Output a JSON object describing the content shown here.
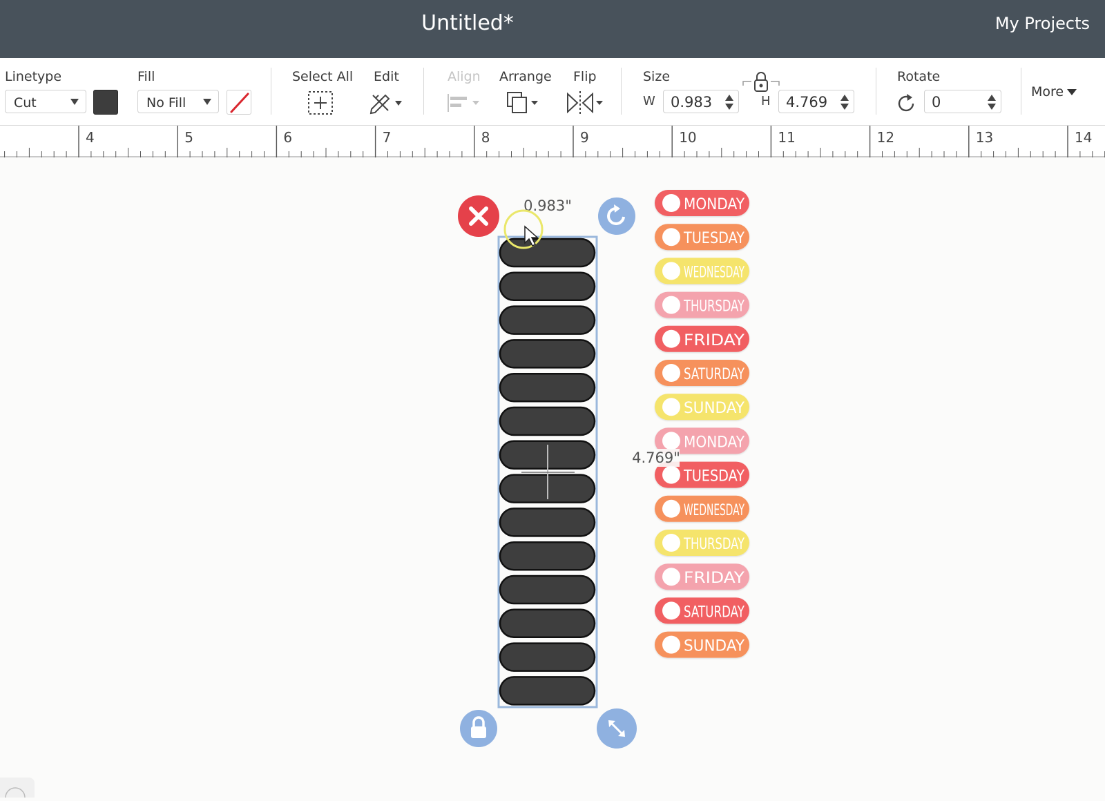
{
  "window": {
    "title": "Untitled*",
    "my_projects": "My Projects"
  },
  "toolbar": {
    "linetype": {
      "label": "Linetype",
      "value": "Cut",
      "color": "#3d3d3d"
    },
    "fill": {
      "label": "Fill",
      "value": "No Fill"
    },
    "select_all": {
      "label": "Select All"
    },
    "edit": {
      "label": "Edit"
    },
    "align": {
      "label": "Align"
    },
    "arrange": {
      "label": "Arrange"
    },
    "flip": {
      "label": "Flip"
    },
    "size": {
      "label": "Size",
      "w_label": "W",
      "w_value": "0.983",
      "h_label": "H",
      "h_value": "4.769"
    },
    "rotate": {
      "label": "Rotate",
      "value": "0"
    },
    "more": {
      "label": "More"
    }
  },
  "ruler": {
    "marks": [
      "4",
      "5",
      "6",
      "7",
      "8",
      "9",
      "10",
      "11",
      "12",
      "13",
      "14"
    ]
  },
  "canvas": {
    "width_readout": "0.983\"",
    "height_readout": "4.769\"",
    "dark_tabs_count": 14,
    "day_labels": [
      {
        "text": "MONDAY",
        "color": "#f15f62"
      },
      {
        "text": "TUESDAY",
        "color": "#f6915c"
      },
      {
        "text": "WEDNESDAY",
        "color": "#f5e46c"
      },
      {
        "text": "THURSDAY",
        "color": "#f4a3ad"
      },
      {
        "text": "FRIDAY",
        "color": "#f15f62"
      },
      {
        "text": "SATURDAY",
        "color": "#f6915c"
      },
      {
        "text": "SUNDAY",
        "color": "#f5e46c"
      },
      {
        "text": "MONDAY",
        "color": "#f4a3ad"
      },
      {
        "text": "TUESDAY",
        "color": "#f15f62"
      },
      {
        "text": "WEDNESDAY",
        "color": "#f6915c"
      },
      {
        "text": "THURSDAY",
        "color": "#f5e46c"
      },
      {
        "text": "FRIDAY",
        "color": "#f4a3ad"
      },
      {
        "text": "SATURDAY",
        "color": "#f15f62"
      },
      {
        "text": "SUNDAY",
        "color": "#f6915c"
      }
    ],
    "colors": {
      "delete": "#e5414a",
      "handle": "#8fb1e0",
      "selection": "#9bb8dc",
      "tab_fill": "#3e3e3e"
    }
  }
}
